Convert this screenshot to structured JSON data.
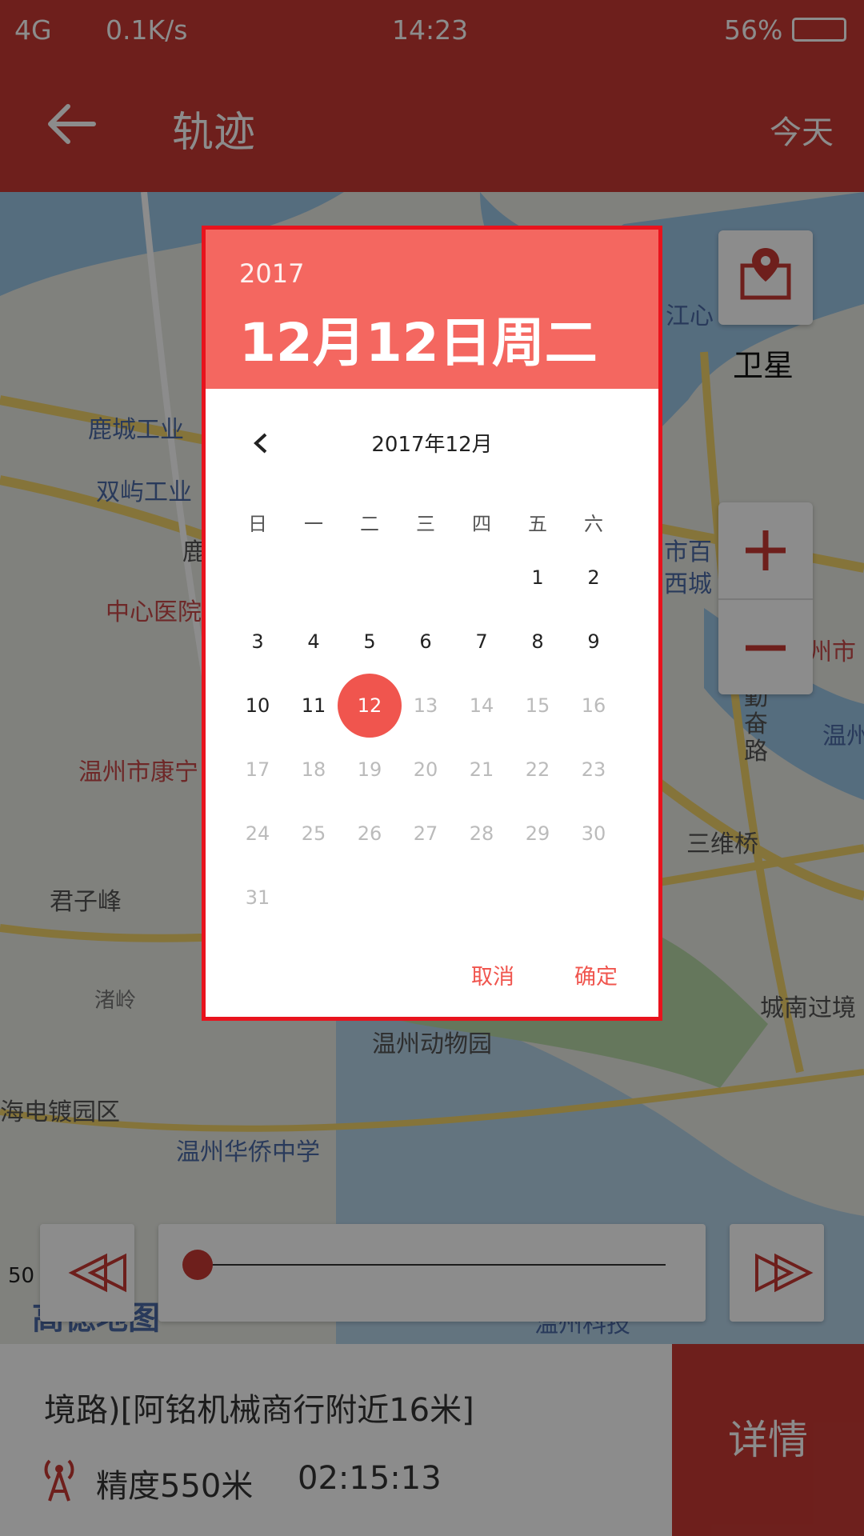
{
  "status_bar": {
    "network": "4G",
    "speed": "0.1K/s",
    "time": "14:23",
    "battery": "56%"
  },
  "app_bar": {
    "title": "轨迹",
    "today": "今天"
  },
  "map": {
    "satellite_label": "卫星",
    "labels": {
      "l1": "鹿城工业",
      "l2": "双屿工业",
      "l3": "中心医院",
      "l4": "温州市康宁",
      "l5": "君子峰",
      "l6": "渚岭",
      "l7": "温州动物园",
      "l8": "海电镀园区",
      "l9": "温州华侨中学",
      "l10": "三维桥",
      "l11": "城南过境",
      "l12": "勤奋路",
      "l13": "江心",
      "l14": "市百",
      "l15": "西城",
      "l16": "温州",
      "l17": "温州科技",
      "l18": "鹿",
      "l19": "州市",
      "l20": "高德地图"
    },
    "scale": "50"
  },
  "bottom": {
    "address": "境路)[阿铭机械商行附近16米]",
    "accuracy": "精度550米",
    "time": "02:15:13",
    "detail_button": "详情"
  },
  "dialog": {
    "year": "2017",
    "selected_date": "12月12日周二",
    "month_title": "2017年12月",
    "weekdays": [
      "日",
      "一",
      "二",
      "三",
      "四",
      "五",
      "六"
    ],
    "days": [
      "1",
      "2",
      "3",
      "4",
      "5",
      "6",
      "7",
      "8",
      "9",
      "10",
      "11",
      "12",
      "13",
      "14",
      "15",
      "16",
      "17",
      "18",
      "19",
      "20",
      "21",
      "22",
      "23",
      "24",
      "25",
      "26",
      "27",
      "28",
      "29",
      "30",
      "31"
    ],
    "selected_day": 12,
    "cancel": "取消",
    "ok": "确定"
  },
  "colors": {
    "brand": "#c93a34",
    "accent": "#f46760",
    "selection": "#f0554e"
  }
}
